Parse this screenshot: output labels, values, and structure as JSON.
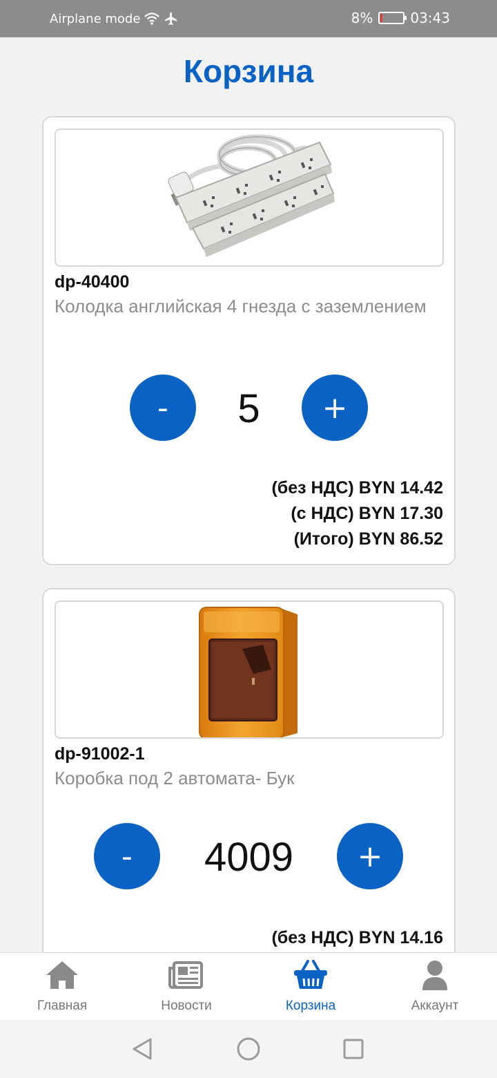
{
  "status_bar": {
    "left_text": "Airplane mode",
    "battery_text": "8%",
    "battery_level": 0.08,
    "time": "03:43",
    "icons": [
      "wifi-icon",
      "airplane-icon",
      "battery-icon"
    ]
  },
  "page": {
    "title": "Корзина"
  },
  "cart": {
    "items": [
      {
        "sku": "dp-40400",
        "description": "Колодка английская 4 гнезда с заземлением",
        "image": "power-strip-image",
        "minus_label": "-",
        "plus_label": "+",
        "quantity": "5",
        "price_no_vat": "(без НДС) BYN 14.42",
        "price_vat": "(с НДС) BYN 17.30",
        "price_total": "(Итого) BYN 86.52"
      },
      {
        "sku": "dp-91002-1",
        "description": "Коробка под 2 автомата- Бук",
        "image": "breaker-box-image",
        "minus_label": "-",
        "plus_label": "+",
        "quantity": "4009",
        "price_no_vat": "(без НДС) BYN 14.16"
      }
    ]
  },
  "bottom_nav": {
    "items": [
      {
        "label": "Главная",
        "icon": "home-icon"
      },
      {
        "label": "Новости",
        "icon": "news-icon"
      },
      {
        "label": "Корзина",
        "icon": "basket-icon",
        "active": true
      },
      {
        "label": "Аккаунт",
        "icon": "account-icon"
      }
    ]
  },
  "colors": {
    "accent": "#0a62c4",
    "status_bar": "#8c8c8c",
    "muted_text": "#8c8c8c",
    "battery_low": "#e53935"
  }
}
